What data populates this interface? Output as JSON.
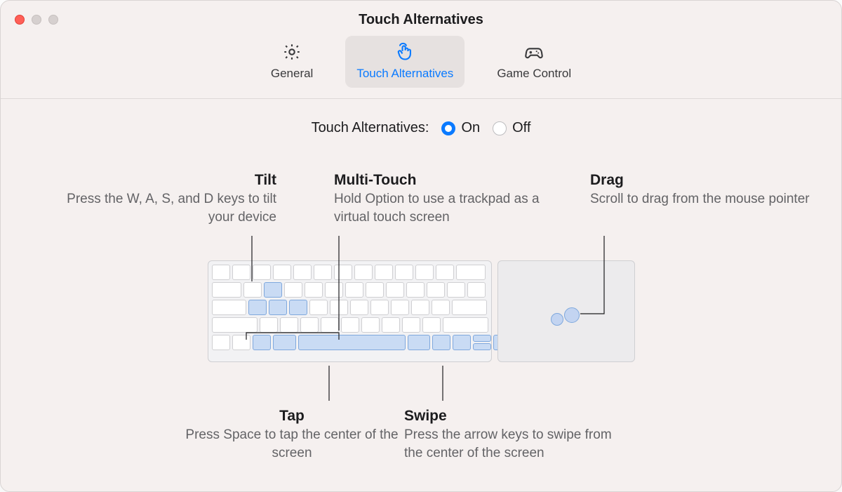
{
  "window": {
    "title": "Touch Alternatives"
  },
  "tabs": {
    "general": {
      "label": "General"
    },
    "touch": {
      "label": "Touch Alternatives"
    },
    "game": {
      "label": "Game Control"
    }
  },
  "toggle": {
    "label": "Touch Alternatives:",
    "on": "On",
    "off": "Off",
    "selected": "on"
  },
  "callouts": {
    "tilt": {
      "title": "Tilt",
      "body": "Press the W, A, S, and D keys to tilt your device"
    },
    "multi": {
      "title": "Multi-Touch",
      "body": "Hold Option to use a trackpad as a virtual touch screen"
    },
    "drag": {
      "title": "Drag",
      "body": "Scroll to drag from the mouse pointer"
    },
    "tap": {
      "title": "Tap",
      "body": "Press Space to tap the center of the screen"
    },
    "swipe": {
      "title": "Swipe",
      "body": "Press the arrow keys to swipe from the center of the screen"
    }
  },
  "keyboard_layout": {
    "rows": [
      {
        "count": 13,
        "last_wide": 1.6,
        "highlight_indices": []
      },
      {
        "lead_wide": 1.6,
        "count": 13,
        "highlight_indices": [
          2
        ]
      },
      {
        "lead_wide": 1.9,
        "count": 12,
        "last_wide": 1.9,
        "highlight_indices": [
          1,
          2,
          3
        ]
      },
      {
        "lead_wide": 2.5,
        "count": 11,
        "last_wide": 2.5,
        "highlight_indices": []
      },
      {
        "variant": "bottom"
      }
    ]
  }
}
